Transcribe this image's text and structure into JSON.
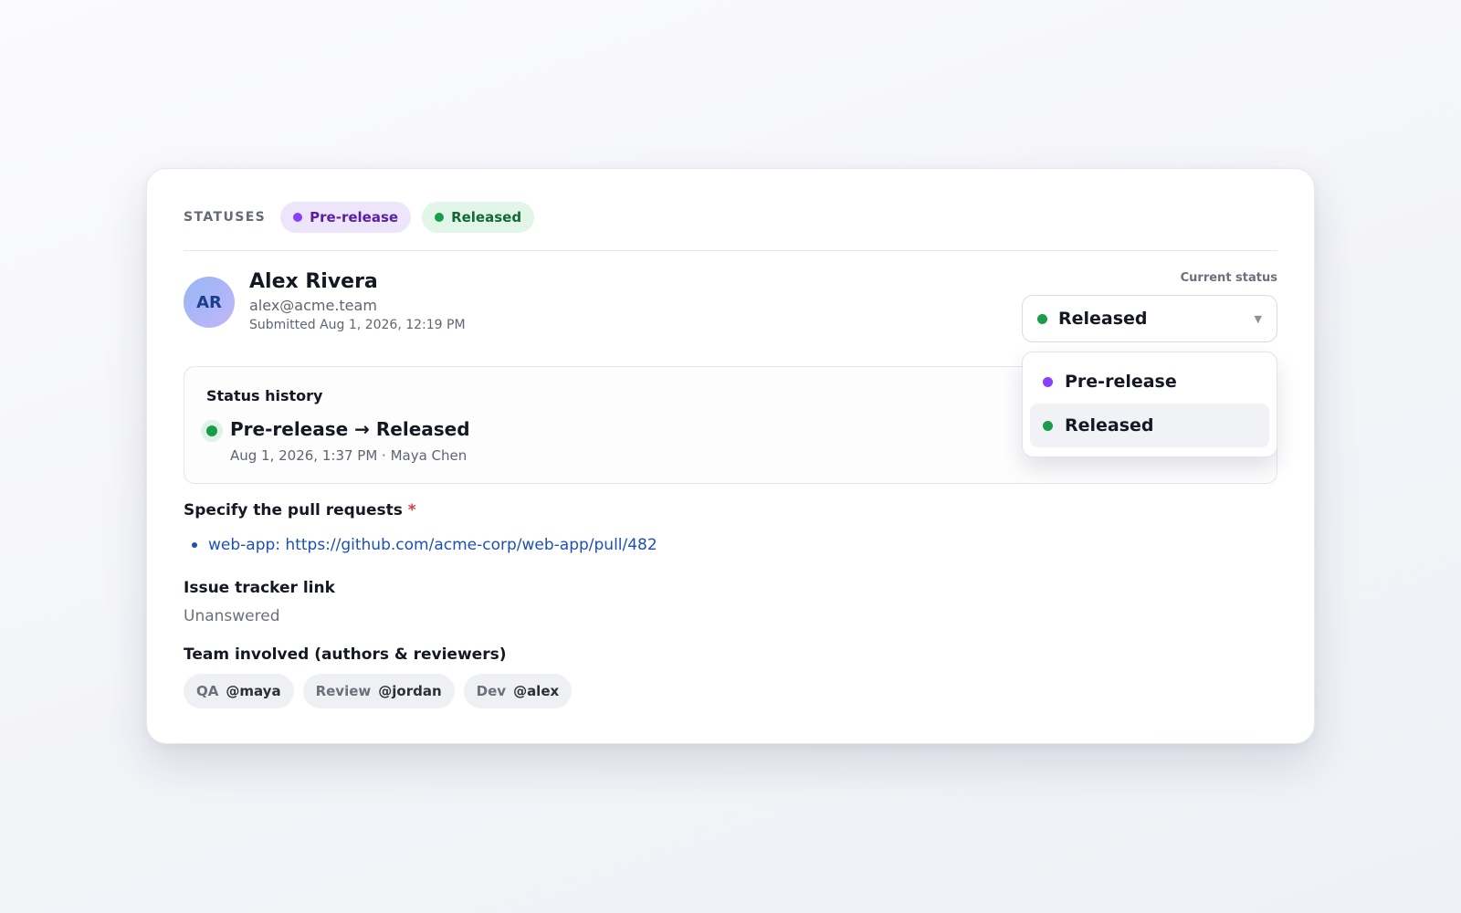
{
  "statuses": {
    "label": "STATUSES",
    "chips": [
      {
        "label": "Pre-release",
        "color": "#8a3ffc"
      },
      {
        "label": "Released",
        "color": "#1a9c4a"
      }
    ]
  },
  "user": {
    "initials": "AR",
    "name": "Alex Rivera",
    "email": "alex@acme.team",
    "submitted": "Submitted Aug 1, 2026, 12:19 PM"
  },
  "current_status": {
    "label": "Current status",
    "value": "Released",
    "options": [
      {
        "label": "Pre-release",
        "color": "#8a3ffc",
        "selected": false
      },
      {
        "label": "Released",
        "color": "#1a9c4a",
        "selected": true
      }
    ]
  },
  "history": {
    "title": "Status history",
    "entries": [
      {
        "change": "Pre-release → Released",
        "meta": "Aug 1, 2026, 1:37 PM · Maya Chen"
      }
    ]
  },
  "questions": {
    "pull_requests": {
      "label": "Specify the pull requests",
      "required_mark": "*",
      "items": [
        "web-app: https://github.com/acme-corp/web-app/pull/482"
      ]
    },
    "issue_tracker": {
      "label": "Issue tracker link",
      "answer": "Unanswered"
    },
    "team": {
      "label": "Team involved (authors & reviewers)",
      "members": [
        {
          "role": "QA",
          "handle": "@maya"
        },
        {
          "role": "Review",
          "handle": "@jordan"
        },
        {
          "role": "Dev",
          "handle": "@alex"
        }
      ]
    }
  }
}
